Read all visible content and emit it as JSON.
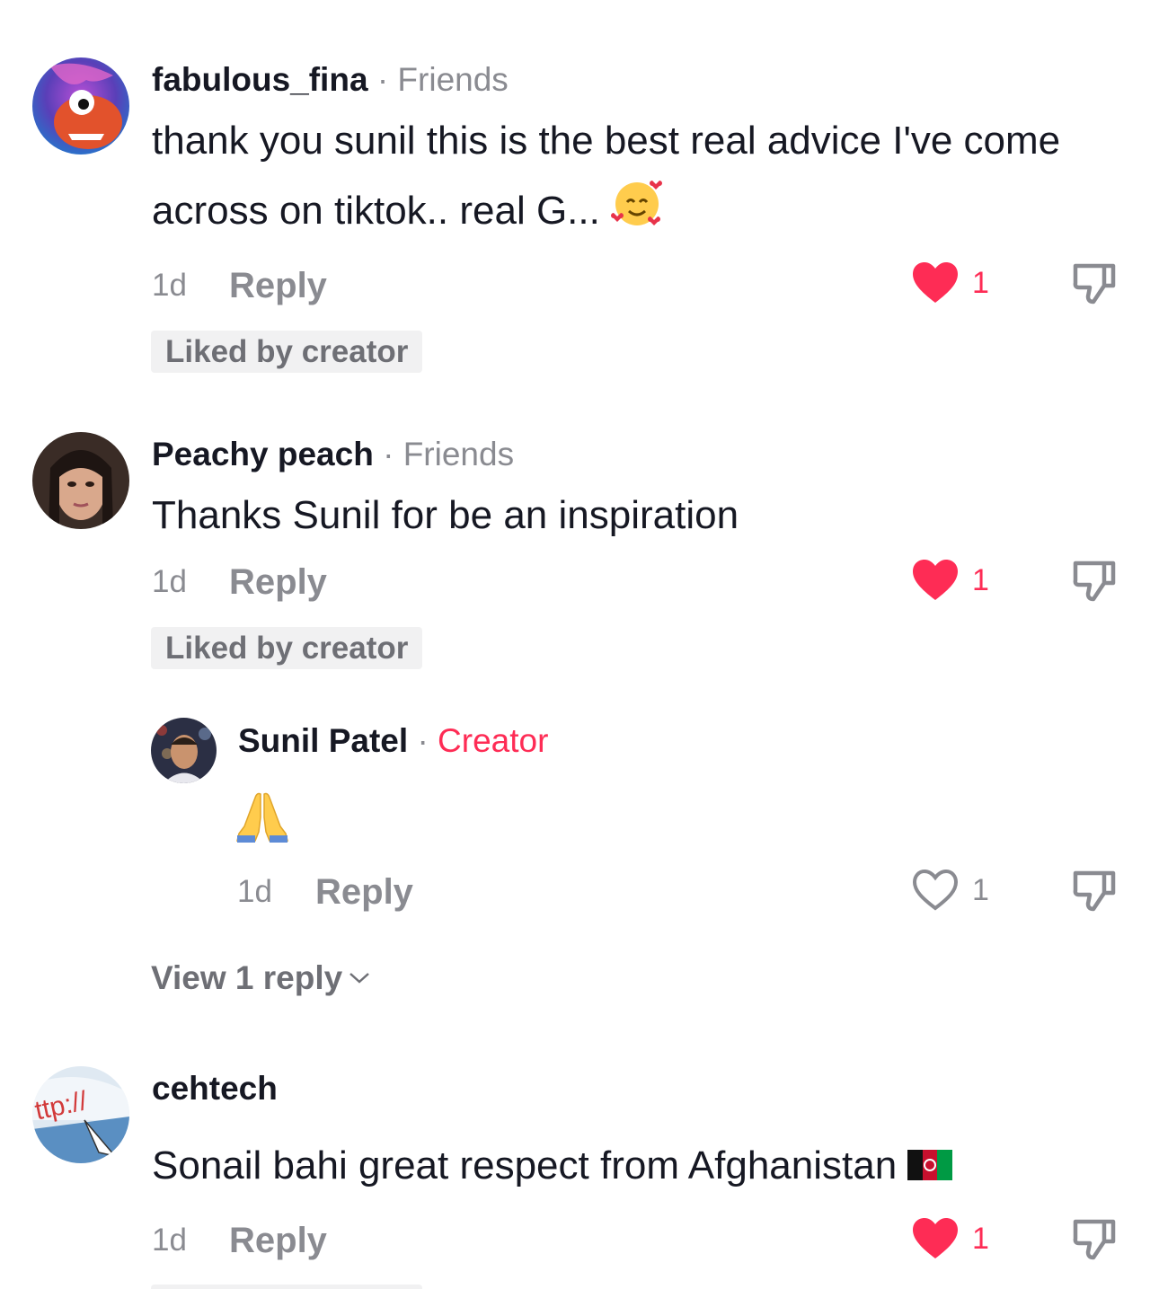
{
  "comments": [
    {
      "username": "fabulous_fina",
      "tag": "Friends",
      "text_line1": "thank you sunil this is the best real advice I've come",
      "text_line2": "across on tiktok.. real G...",
      "time": "1d",
      "reply_label": "Reply",
      "like_count": "1",
      "badge": "Liked by creator"
    },
    {
      "username": "Peachy peach",
      "tag": "Friends",
      "text": "Thanks Sunil for be an inspiration",
      "time": "1d",
      "reply_label": "Reply",
      "like_count": "1",
      "badge": "Liked by creator"
    },
    {
      "username": "cehtech",
      "text": "Sonail bahi great respect from Afghanistan",
      "time": "1d",
      "reply_label": "Reply",
      "like_count": "1"
    }
  ],
  "reply": {
    "username": "Sunil Patel",
    "tag": "Creator",
    "time": "1d",
    "reply_label": "Reply",
    "like_count": "1"
  },
  "view_replies": "View 1 reply",
  "separator": "·",
  "colors": {
    "accent": "#fe2c55",
    "muted": "#8a8b91",
    "badge_bg": "#f1f1f2"
  }
}
